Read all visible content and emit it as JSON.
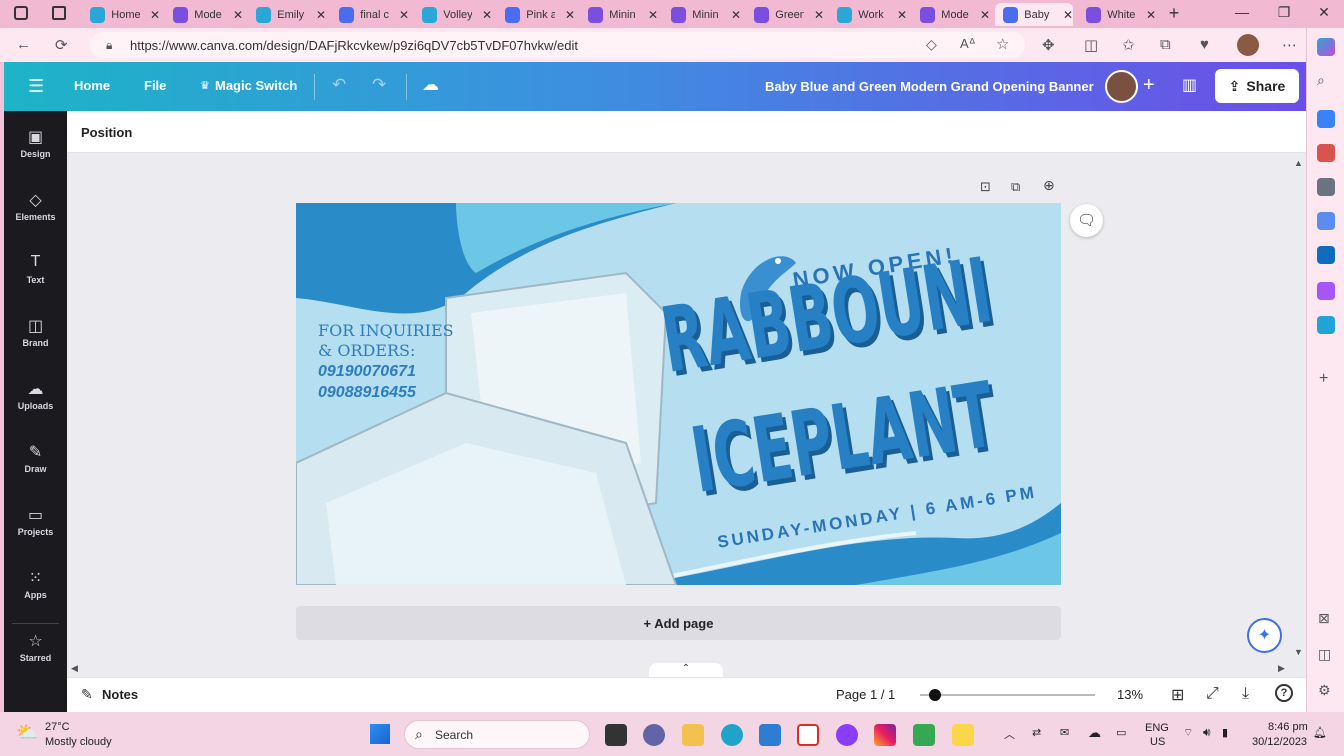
{
  "browser": {
    "tabs": [
      {
        "label": "Home",
        "color": "#2aa7d8"
      },
      {
        "label": "Mode",
        "color": "#7a4fe0"
      },
      {
        "label": "Emily",
        "color": "#2aa7d8"
      },
      {
        "label": "final c",
        "color": "#4a6cf0"
      },
      {
        "label": "Volley",
        "color": "#2aa7d8"
      },
      {
        "label": "Pink a",
        "color": "#4a6cf0"
      },
      {
        "label": "Minin",
        "color": "#7a4fe0"
      },
      {
        "label": "Minin",
        "color": "#7a4fe0"
      },
      {
        "label": "Green",
        "color": "#7a4fe0"
      },
      {
        "label": "Work",
        "color": "#2aa7d8"
      },
      {
        "label": "Mode",
        "color": "#7a4fe0"
      },
      {
        "label": "Baby",
        "color": "#4a6cf0",
        "active": true
      },
      {
        "label": "White",
        "color": "#7a4fe0"
      }
    ],
    "url": "https://www.canva.com/design/DAFjRkcvkew/p9zi6qDV7cb5TvDF07hvkw/edit"
  },
  "canva": {
    "home": "Home",
    "file": "File",
    "magic_switch": "Magic Switch",
    "design_title": "Baby Blue and Green Modern Grand Opening Banner",
    "share": "Share",
    "toolbar_position": "Position",
    "add_page": "+ Add page",
    "notes": "Notes",
    "page_indicator": "Page 1 / 1",
    "zoom": "13%",
    "zoom_level": 0.05
  },
  "rail": [
    {
      "label": "Design",
      "icon": "▣"
    },
    {
      "label": "Elements",
      "icon": "◇"
    },
    {
      "label": "Text",
      "icon": "T"
    },
    {
      "label": "Brand",
      "icon": "◫"
    },
    {
      "label": "Uploads",
      "icon": "☁"
    },
    {
      "label": "Draw",
      "icon": "✎"
    },
    {
      "label": "Projects",
      "icon": "▭"
    },
    {
      "label": "Apps",
      "icon": "⁙"
    },
    {
      "label": "Starred",
      "icon": "☆"
    }
  ],
  "banner": {
    "inquiry_line1": "FOR INQUIRIES",
    "inquiry_line2": "& ORDERS:",
    "phone1": "09190070671",
    "phone2": "09088916455",
    "now_open": "NOW OPEN!",
    "brand1": "RABBOUNI",
    "brand2": "ICEPLANT",
    "hours": "SUNDAY-MONDAY | 6 AM-6 PM"
  },
  "taskbar": {
    "temp": "27°C",
    "weather": "Mostly cloudy",
    "search": "Search",
    "lang1": "ENG",
    "lang2": "US",
    "time": "8:46 pm",
    "date": "30/12/2023"
  }
}
